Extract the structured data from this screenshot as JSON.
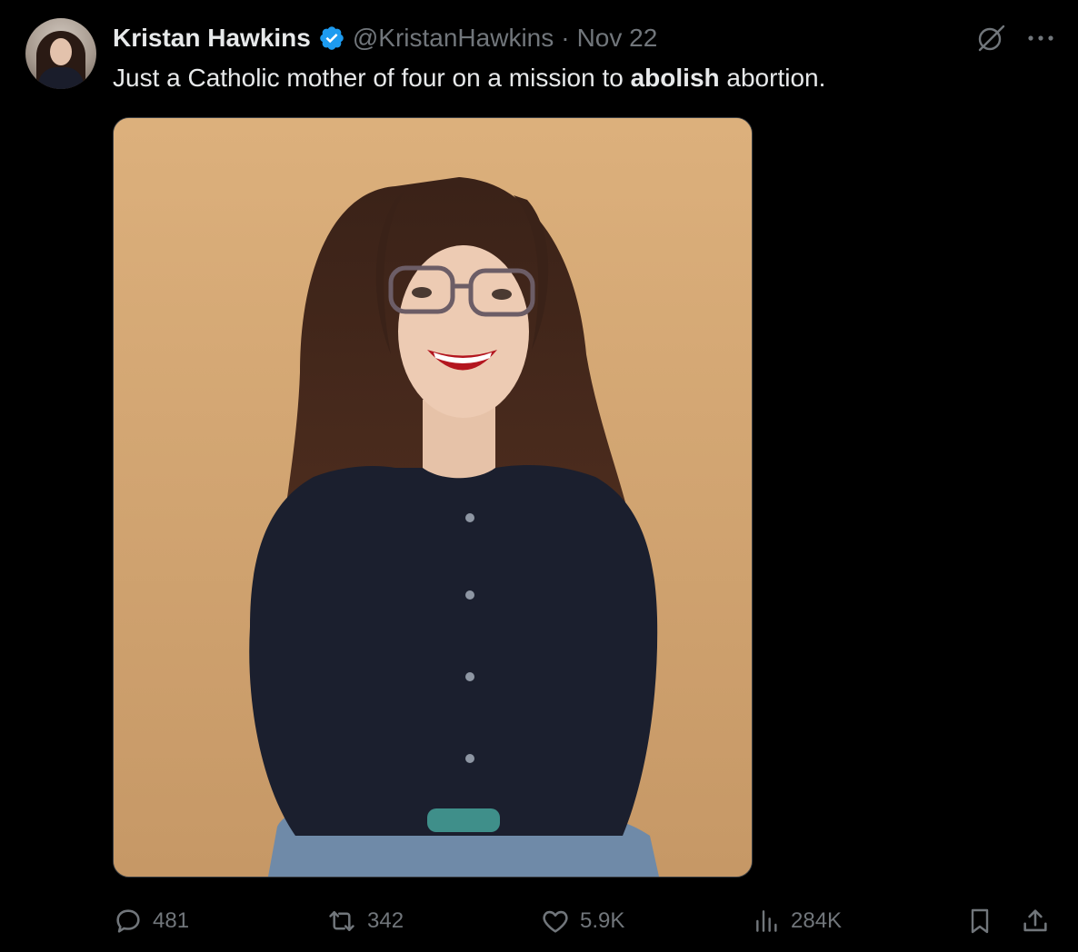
{
  "tweet": {
    "author_name": "Kristan Hawkins",
    "handle": "@KristanHawkins",
    "separator": "·",
    "date": "Nov 22",
    "text_before": "Just a Catholic mother of four on a mission to ",
    "text_bold": "abolish",
    "text_after": " abortion."
  },
  "actions": {
    "replies": "481",
    "reposts": "342",
    "likes": "5.9K",
    "views": "284K"
  },
  "colors": {
    "background": "#000000",
    "text": "#e7e9ea",
    "muted": "#71767b",
    "verified": "#1d9bf0"
  },
  "icons": [
    "grok-icon",
    "more-icon",
    "reply-icon",
    "repost-icon",
    "like-icon",
    "views-icon",
    "bookmark-icon",
    "share-icon"
  ]
}
